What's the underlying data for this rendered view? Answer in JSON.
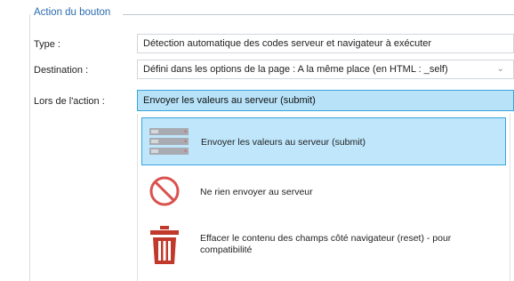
{
  "group": {
    "legend": "Action du bouton"
  },
  "rows": {
    "type": {
      "label": "Type :",
      "value": "Détection automatique des codes serveur et navigateur à exécuter"
    },
    "destination": {
      "label": "Destination :",
      "value": "Défini dans les options de la page : A la même place (en HTML : _self)"
    },
    "action": {
      "label": "Lors de l'action :",
      "value": "Envoyer les valeurs au serveur (submit)"
    }
  },
  "dropdown": {
    "options": [
      {
        "label": "Envoyer les valeurs au serveur (submit)",
        "icon": "submit-form-icon",
        "selected": true
      },
      {
        "label": "Ne rien envoyer au serveur",
        "icon": "no-entry-icon",
        "selected": false
      },
      {
        "label": "Effacer le contenu des champs côté navigateur (reset) - pour compatibilité",
        "icon": "trash-icon",
        "selected": false
      }
    ]
  },
  "colors": {
    "accent": "#39a6de",
    "highlight": "#b7e2f8",
    "danger": "#d9534f",
    "trash": "#c0392b"
  }
}
